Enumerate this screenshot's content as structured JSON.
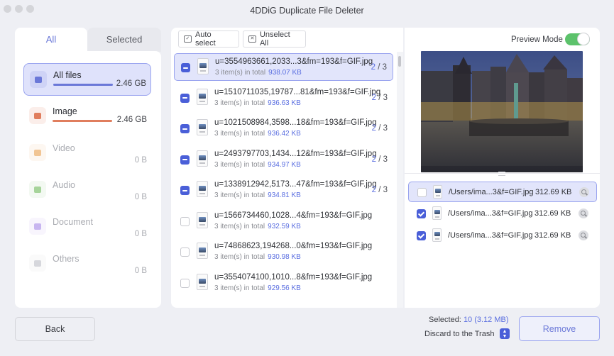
{
  "window": {
    "title": "4DDiG Duplicate File Deleter"
  },
  "sidebar": {
    "tabs": [
      {
        "label": "All",
        "active": true
      },
      {
        "label": "Selected",
        "active": false
      }
    ],
    "categories": [
      {
        "label": "All files",
        "size": "2.46 GB",
        "icon": "folder-icon",
        "color": "#6b78d8",
        "fill": 1.0,
        "active": true
      },
      {
        "label": "Image",
        "size": "2.46 GB",
        "icon": "image-icon",
        "color": "#e07e5e",
        "fill": 1.0,
        "active": false
      },
      {
        "label": "Video",
        "size": "0 B",
        "icon": "video-icon",
        "color": "#f1c594",
        "fill": 0,
        "active": false
      },
      {
        "label": "Audio",
        "size": "0 B",
        "icon": "microphone-icon",
        "color": "#a6d49a",
        "fill": 0,
        "active": false
      },
      {
        "label": "Document",
        "size": "0 B",
        "icon": "document-icon",
        "color": "#c8b6f0",
        "fill": 0,
        "active": false
      },
      {
        "label": "Others",
        "size": "0 B",
        "icon": "grid-icon",
        "color": "#d6d7dc",
        "fill": 0,
        "active": false
      }
    ]
  },
  "toolbar": {
    "auto_select_label": "Auto select",
    "unselect_all_label": "Unselect All"
  },
  "groups": [
    {
      "name": "u=3554963661,2033...3&fm=193&f=GIF.jpg",
      "items_text": "3 item(s) in total",
      "size": "938.07 KB",
      "selected": "2",
      "total": "/ 3",
      "state": "partial",
      "active": true
    },
    {
      "name": "u=1510711035,19787...81&fm=193&f=GIF.jpg",
      "items_text": "3 item(s) in total",
      "size": "936.63 KB",
      "selected": "2",
      "total": "/ 3",
      "state": "partial",
      "active": false
    },
    {
      "name": "u=1021508984,3598...18&fm=193&f=GIF.jpg",
      "items_text": "3 item(s) in total",
      "size": "936.42 KB",
      "selected": "2",
      "total": "/ 3",
      "state": "partial",
      "active": false
    },
    {
      "name": "u=2493797703,1434...12&fm=193&f=GIF.jpg",
      "items_text": "3 item(s) in total",
      "size": "934.97 KB",
      "selected": "2",
      "total": "/ 3",
      "state": "partial",
      "active": false
    },
    {
      "name": "u=1338912942,5173...47&fm=193&f=GIF.jpg",
      "items_text": "3 item(s) in total",
      "size": "934.81 KB",
      "selected": "2",
      "total": "/ 3",
      "state": "partial",
      "active": false
    },
    {
      "name": "u=1566734460,1028...4&fm=193&f=GIF.jpg",
      "items_text": "3 item(s) in total",
      "size": "932.59 KB",
      "selected": "",
      "total": "",
      "state": "empty",
      "active": false
    },
    {
      "name": "u=74868623,194268...0&fm=193&f=GIF.jpg",
      "items_text": "3 item(s) in total",
      "size": "930.98 KB",
      "selected": "",
      "total": "",
      "state": "empty",
      "active": false
    },
    {
      "name": "u=3554074100,1010...8&fm=193&f=GIF.jpg",
      "items_text": "3 item(s) in total",
      "size": "929.56 KB",
      "selected": "",
      "total": "",
      "state": "empty",
      "active": false
    }
  ],
  "preview": {
    "mode_label": "Preview Mode",
    "mode_on": true,
    "duplicates": [
      {
        "path": "/Users/ima...3&f=GIF.jpg",
        "size": "312.69 KB",
        "checked": false,
        "active": true
      },
      {
        "path": "/Users/ima...3&f=GIF.jpg",
        "size": "312.69 KB",
        "checked": true,
        "active": false
      },
      {
        "path": "/Users/ima...3&f=GIF.jpg",
        "size": "312.69 KB",
        "checked": true,
        "active": false
      }
    ]
  },
  "footer": {
    "back_label": "Back",
    "selected_label": "Selected:",
    "selected_value": "10 (3.12 MB)",
    "discard_label": "Discard to the Trash",
    "remove_label": "Remove"
  },
  "colors": {
    "accent": "#4a5fd8",
    "accent_text": "#5a6ee0",
    "toggle_on": "#5cc26b"
  }
}
